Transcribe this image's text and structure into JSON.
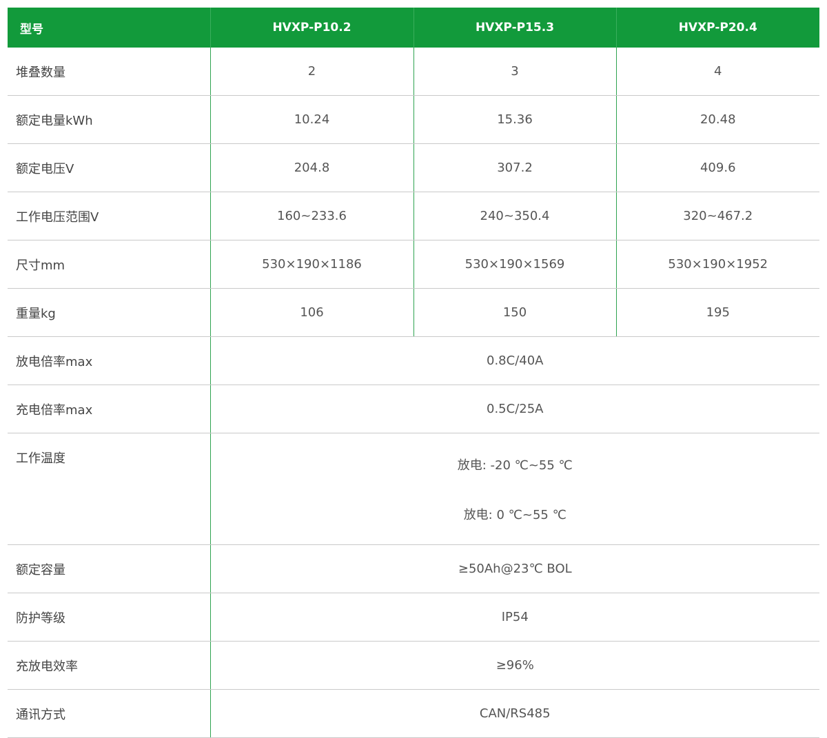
{
  "header": {
    "label": "型号",
    "models": [
      "HVXP-P10.2",
      "HVXP-P15.3",
      "HVXP-P20.4"
    ]
  },
  "rows": [
    {
      "label": "堆叠数量",
      "values": [
        "2",
        "3",
        "4"
      ]
    },
    {
      "label": "额定电量kWh",
      "values": [
        "10.24",
        "15.36",
        "20.48"
      ]
    },
    {
      "label": "额定电压V",
      "values": [
        "204.8",
        "307.2",
        "409.6"
      ]
    },
    {
      "label": "工作电压范围V",
      "values": [
        "160~233.6",
        "240~350.4",
        "320~467.2"
      ]
    },
    {
      "label": "尺寸mm",
      "values": [
        "530×190×1186",
        "530×190×1569",
        "530×190×1952"
      ]
    },
    {
      "label": "重量kg",
      "values": [
        "106",
        "150",
        "195"
      ]
    }
  ],
  "shared_rows": [
    {
      "label": "放电倍率max",
      "value": "0.8C/40A"
    },
    {
      "label": "充电倍率max",
      "value": "0.5C/25A"
    }
  ],
  "temperature": {
    "label": "工作温度",
    "lines": [
      "放电: -20 ℃~55 ℃",
      "放电: 0 ℃~55 ℃"
    ]
  },
  "shared_rows_2": [
    {
      "label": "额定容量",
      "value": "≥50Ah@23℃ BOL"
    },
    {
      "label": "防护等级",
      "value": "IP54"
    },
    {
      "label": "充放电效率",
      "value": "≥96%"
    },
    {
      "label": "通讯方式",
      "value": "CAN/RS485"
    }
  ],
  "colors": {
    "header_green": "#129a3b",
    "divider_green": "#2ea24f",
    "row_divider": "#c9c9c9"
  }
}
